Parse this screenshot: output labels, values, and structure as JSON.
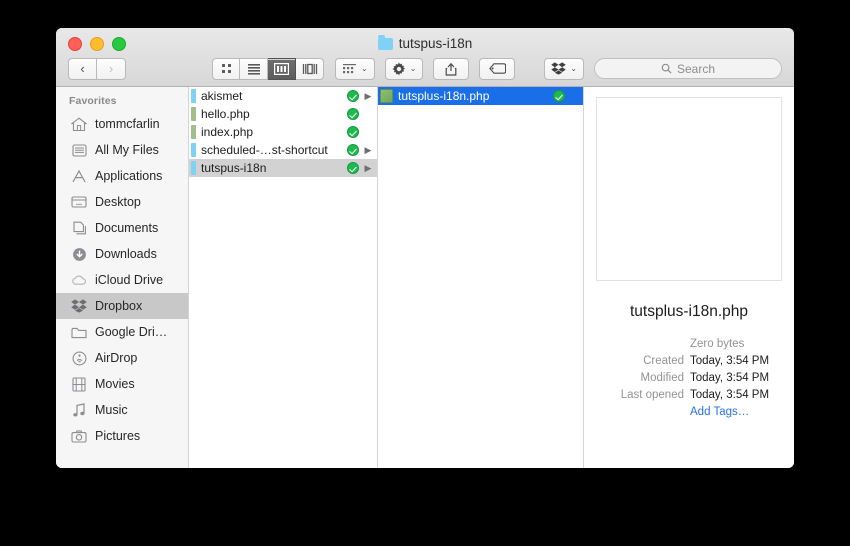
{
  "window": {
    "title": "tutspus-i18n",
    "title_icon": "folder-icon",
    "traffic_lights": {
      "close": "close-button",
      "minimize": "minimize-button",
      "maximize": "maximize-button"
    }
  },
  "toolbar": {
    "back_glyph": "‹",
    "forward_glyph": "›",
    "view_icon_label": "icon-view",
    "view_list_label": "list-view",
    "view_column_label": "column-view",
    "view_coverflow_label": "coverflow-view",
    "arrange_label": "arrange-button",
    "action_label": "action-gear-button",
    "share_label": "share-button",
    "tag_label": "tag-button",
    "dropbox_label": "dropbox-button",
    "caret_glyph": "⌄"
  },
  "search": {
    "placeholder": "Search",
    "value": "",
    "icon": "search-icon"
  },
  "sidebar": {
    "header": "Favorites",
    "items": [
      {
        "label": "tommcfarlin",
        "icon": "home-icon",
        "selected": false
      },
      {
        "label": "All My Files",
        "icon": "all-my-files-icon",
        "selected": false
      },
      {
        "label": "Applications",
        "icon": "applications-icon",
        "selected": false
      },
      {
        "label": "Desktop",
        "icon": "desktop-icon",
        "selected": false
      },
      {
        "label": "Documents",
        "icon": "documents-icon",
        "selected": false
      },
      {
        "label": "Downloads",
        "icon": "downloads-icon",
        "selected": false
      },
      {
        "label": "iCloud Drive",
        "icon": "icloud-icon",
        "selected": false
      },
      {
        "label": "Dropbox",
        "icon": "dropbox-icon",
        "selected": true
      },
      {
        "label": "Google Dri…",
        "icon": "folder-icon",
        "selected": false
      },
      {
        "label": "AirDrop",
        "icon": "airdrop-icon",
        "selected": false
      },
      {
        "label": "Movies",
        "icon": "movies-icon",
        "selected": false
      },
      {
        "label": "Music",
        "icon": "music-icon",
        "selected": false
      },
      {
        "label": "Pictures",
        "icon": "pictures-icon",
        "selected": false
      }
    ]
  },
  "columns": [
    {
      "name": "column-one",
      "rows": [
        {
          "name": "akismet",
          "kind": "folder",
          "badge": "synced",
          "has_arrow": true,
          "selected": false
        },
        {
          "name": "hello.php",
          "kind": "php",
          "badge": "synced",
          "has_arrow": false,
          "selected": false
        },
        {
          "name": "index.php",
          "kind": "php",
          "badge": "synced",
          "has_arrow": false,
          "selected": false
        },
        {
          "name": "scheduled-…st-shortcut",
          "kind": "folder",
          "badge": "synced",
          "has_arrow": true,
          "selected": false
        },
        {
          "name": "tutspus-i18n",
          "kind": "folder",
          "badge": "synced",
          "has_arrow": true,
          "selected": true
        }
      ]
    },
    {
      "name": "column-two",
      "rows": [
        {
          "name": "tutsplus-i18n.php",
          "kind": "phpfull",
          "badge": "synced",
          "has_arrow": false,
          "selected": true
        }
      ]
    }
  ],
  "preview": {
    "thumbnail": "blank-document-preview",
    "filename": "tutsplus-i18n.php",
    "size": "Zero bytes",
    "metadata": [
      {
        "key": "Created",
        "value": "Today, 3:54 PM"
      },
      {
        "key": "Modified",
        "value": "Today, 3:54 PM"
      },
      {
        "key": "Last opened",
        "value": "Today, 3:54 PM"
      }
    ],
    "add_tags_label": "Add Tags…"
  },
  "colors": {
    "selection_blue": "#1a6fe8",
    "selection_gray": "#d2d2d2",
    "sync_badge_green": "#1eba4e",
    "folder_blue": "#7fd2f5",
    "link_blue": "#2b72e8"
  }
}
